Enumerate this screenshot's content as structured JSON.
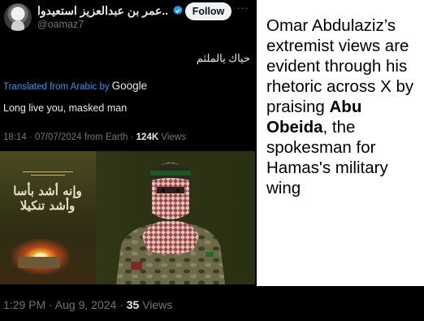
{
  "embedded_tweet": {
    "author_name": "عمر بن عبدالعزيز استعيدوا...",
    "handle": "@oamaz7",
    "follow_label": "Follow",
    "more_label": "···",
    "original_text": "حياك يالملثم",
    "translated_from": "Translated from Arabic by",
    "translator": "Google",
    "translation": "Long live you, masked man",
    "time": "18:14 · 07/07/2024 from Earth · ",
    "views_count": "124K",
    "views_label": " Views",
    "poster_text": "وإنه أشد بأسا وأشد تنكيلا"
  },
  "caption": {
    "part1": "Omar Abdulaziz’s extremist views are evident through his rhetoric across X by praising ",
    "bold": "Abu Obeida",
    "part2": ", the spokesman for Hamas's military wing"
  },
  "footer": {
    "time": "1:29 PM · Aug 9, 2024 · ",
    "views_count": "35",
    "views_label": " Views"
  },
  "colors": {
    "background": "#000000",
    "link_blue": "#1d9bf0",
    "muted_gray": "#71767b",
    "verified_blue": "#1d9bf0",
    "caption_bg": "#ffffff"
  },
  "icons": [
    "verified-badge-icon",
    "more-options-icon",
    "user-avatar"
  ]
}
